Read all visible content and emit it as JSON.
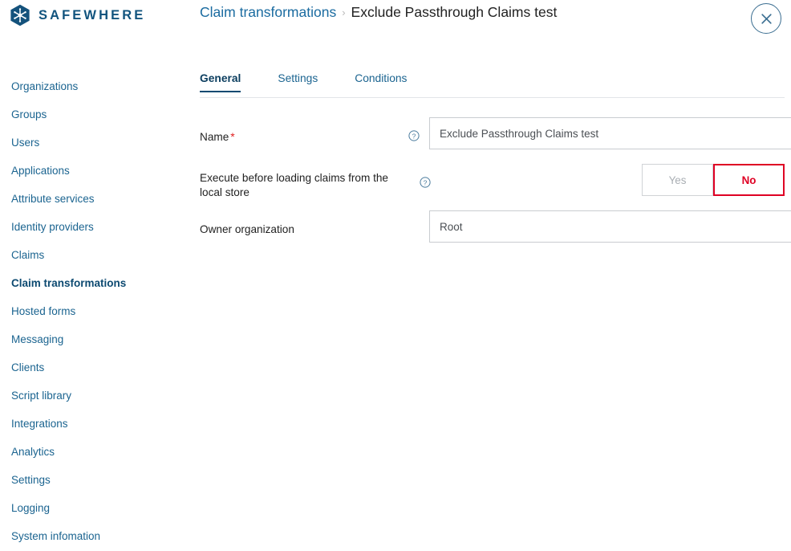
{
  "brand": {
    "name": "SAFEWHERE",
    "logo_icon": "snowflake-hexagon-logo",
    "logo_color": "#14527c"
  },
  "header": {
    "breadcrumb": {
      "parent": "Claim transformations",
      "separator": "›",
      "current": "Exclude Passthrough Claims test"
    },
    "close_button": {
      "icon": "close-icon",
      "label": "Close"
    },
    "link_color": "#1a6ba0"
  },
  "sidebar": {
    "items": [
      {
        "label": "Organizations",
        "active": false
      },
      {
        "label": "Groups",
        "active": false
      },
      {
        "label": "Users",
        "active": false
      },
      {
        "label": "Applications",
        "active": false
      },
      {
        "label": "Attribute services",
        "active": false
      },
      {
        "label": "Identity providers",
        "active": false
      },
      {
        "label": "Claims",
        "active": false
      },
      {
        "label": "Claim transformations",
        "active": true
      },
      {
        "label": "Hosted forms",
        "active": false
      },
      {
        "label": "Messaging",
        "active": false
      },
      {
        "label": "Clients",
        "active": false
      },
      {
        "label": "Script library",
        "active": false
      },
      {
        "label": "Integrations",
        "active": false
      },
      {
        "label": "Analytics",
        "active": false
      },
      {
        "label": "Settings",
        "active": false
      },
      {
        "label": "Logging",
        "active": false
      },
      {
        "label": "System infomation",
        "active": false
      }
    ]
  },
  "main": {
    "tabs": [
      {
        "label": "General",
        "active": true
      },
      {
        "label": "Settings",
        "active": false
      },
      {
        "label": "Conditions",
        "active": false
      }
    ],
    "form": {
      "name_field": {
        "label": "Name",
        "required_marker": "*",
        "help_icon": "help-circle-icon",
        "value": "Exclude Passthrough Claims test",
        "placeholder": "Name"
      },
      "execute_before_loading": {
        "label": "Execute before loading claims from the local store",
        "help_icon": "help-circle-icon",
        "options": [
          {
            "label": "Yes",
            "selected": false
          },
          {
            "label": "No",
            "selected": true
          }
        ],
        "selected_value": "No",
        "selected_color": "#df0024"
      },
      "owner_organization": {
        "label": "Owner organization",
        "value": "Root",
        "options": [
          "Root"
        ],
        "chevron_icon": "chevron-down-icon"
      }
    }
  }
}
